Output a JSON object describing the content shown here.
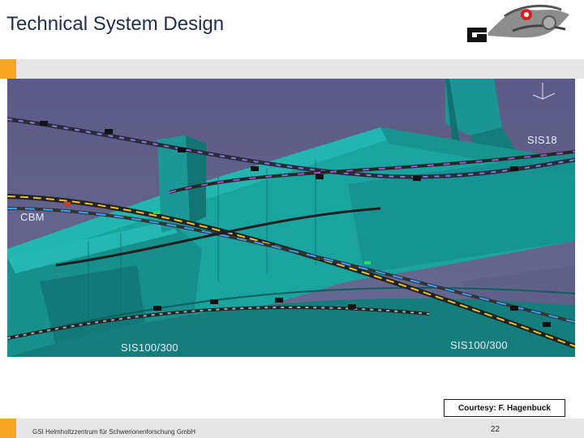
{
  "slide": {
    "title": "Technical System Design",
    "courtesy": "Courtesy: F. Hagenbuck",
    "footer": "GSI Helmholtzzentrum für Schwerionenforschung GmbH",
    "page_number": "22"
  },
  "labels": {
    "sis18": "SIS18",
    "cbm": "CBM",
    "sis100_left": "SIS100/300",
    "sis100_right": "SIS100/300"
  },
  "colors": {
    "accent": "#f5a623",
    "bar": "#e6e6e6",
    "building": "#1fa3a0",
    "background": "#5a5a82"
  },
  "icons": {
    "logo": "gsi-logo-icon"
  }
}
